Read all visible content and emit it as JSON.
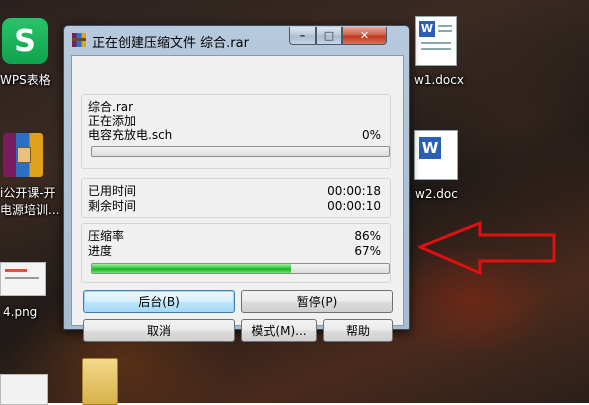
{
  "desktop": {
    "icons": [
      {
        "name": "wps-icon",
        "label": "WPS表格"
      },
      {
        "name": "rar-folder-icon",
        "label_line1": "i公开课-开",
        "label_line2": "电源培训..."
      },
      {
        "name": "png-icon",
        "label": "4.png"
      },
      {
        "name": "docx-icon",
        "label": "w1.docx"
      },
      {
        "name": "doc-icon",
        "label": "w2.doc"
      }
    ]
  },
  "dialog": {
    "title": "正在创建压缩文件 综合.rar",
    "controls": {
      "minimize": "–",
      "maximize": "□",
      "close": "✕"
    },
    "archive_name": "综合.rar",
    "status": "正在添加",
    "current_file": "电容充放电.sch",
    "file_percent": "0%",
    "file_progress": 0,
    "elapsed_label": "已用时间",
    "elapsed_value": "00:00:18",
    "remaining_label": "剩余时间",
    "remaining_value": "00:00:10",
    "ratio_label": "压缩率",
    "ratio_value": "86%",
    "progress_label": "进度",
    "progress_value": "67%",
    "total_progress": 0.67,
    "buttons": {
      "background": "后台(B)",
      "pause": "暂停(P)",
      "cancel": "取消",
      "mode": "模式(M)...",
      "help": "帮助"
    }
  },
  "colors": {
    "progress_green": "#2ebd31",
    "annotation_red": "#e01010"
  }
}
